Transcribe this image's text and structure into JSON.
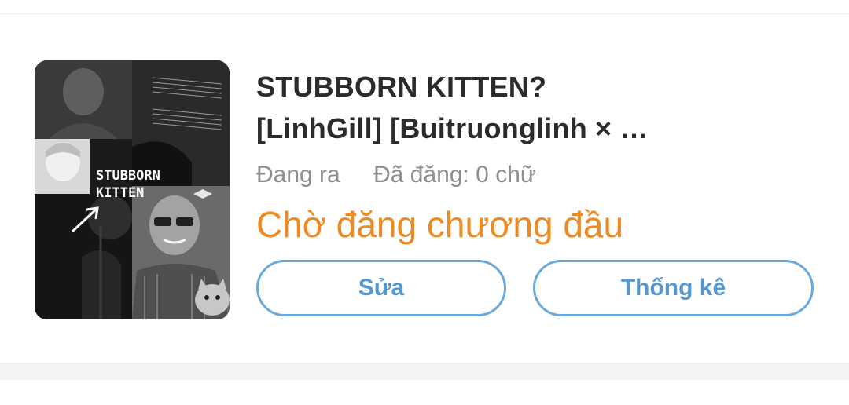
{
  "story": {
    "title_line1": "STUBBORN KITTEN?",
    "title_line2": "[LinhGill] [Buitruonglinh × …",
    "status": "Đang ra",
    "posted": "Đã đăng: 0 chữ",
    "pending": "Chờ đăng chương đầu",
    "cover_text_line1": "STUBBORN",
    "cover_text_line2": "KITTEN"
  },
  "actions": {
    "edit_label": "Sửa",
    "stats_label": "Thống kê"
  },
  "colors": {
    "accent_orange": "#ee8a22",
    "button_blue": "#5598cf",
    "title": "#2b2b2b",
    "meta_gray": "#8e8e8e"
  }
}
